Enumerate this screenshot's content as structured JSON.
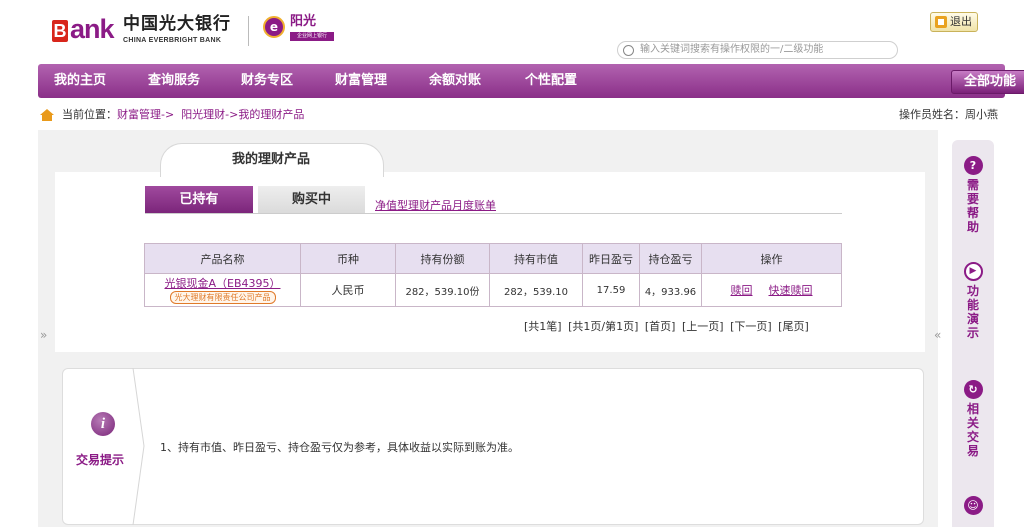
{
  "header": {
    "logo_letter": "B",
    "logo_word": "ank",
    "bank_name_cn": "中国光大银行",
    "bank_name_en": "CHINA EVERBRIGHT BANK",
    "sub_badge_letter": "e",
    "sub_brand": "阳光",
    "sub_brand_sub": "企业网上银行",
    "search_placeholder": "输入关键词搜索有操作权限的一/二级功能",
    "logout_label": "退出"
  },
  "nav": {
    "items": [
      "我的主页",
      "查询服务",
      "财务专区",
      "财富管理",
      "余额对账",
      "个性配置"
    ],
    "all_functions": "全部功能"
  },
  "breadcrumb": {
    "prefix": "当前位置：",
    "level1": "财富管理->",
    "level2": "阳光理财->我的理财产品"
  },
  "operator": "操作员姓名：周小燕",
  "page_tab": "我的理财产品",
  "tabs": {
    "holding": "已持有",
    "buying": "购买中",
    "statement_link": "净值型理财产品月度账单"
  },
  "table": {
    "headers": [
      "产品名称",
      "币种",
      "持有份额",
      "持有市值",
      "昨日盈亏",
      "持仓盈亏",
      "操作"
    ],
    "rows": [
      {
        "product": "光银现金A（EB4395）",
        "tag": "光大理财有限责任公司产品",
        "currency": "人民币",
        "shares": "282，539.10份",
        "market_value": "282，539.10",
        "yesterday_pnl": "17.59",
        "position_pnl": "4，933.96",
        "op_redeem": "赎回",
        "op_fast_redeem": "快速赎回"
      }
    ]
  },
  "pager": {
    "total": "[共1笔]",
    "pages": "[共1页/第1页]",
    "first": "[首页]",
    "prev": "[上一页]",
    "next": "[下一页]",
    "last": "[尾页]"
  },
  "arrows": {
    "left": "»",
    "right": "«"
  },
  "tips": {
    "icon_letter": "i",
    "label": "交易提示",
    "text": "1、持有市值、昨日盈亏、持仓盈亏仅为参考，具体收益以实际到账为准。"
  },
  "sidebar": {
    "help": {
      "icon": "?",
      "label": "需要帮助"
    },
    "demo": {
      "icon": "▶",
      "label": "功能演示"
    },
    "related": {
      "icon": "↻",
      "label": "相关交易"
    },
    "more": {
      "icon": "☺"
    }
  },
  "colors": {
    "brand_purple": "#8b1b86",
    "nav_gradient_top": "#b263b0",
    "nav_gradient_bottom": "#8a2f88",
    "logo_red": "#d8261b",
    "accent_orange": "#e07a2a"
  }
}
